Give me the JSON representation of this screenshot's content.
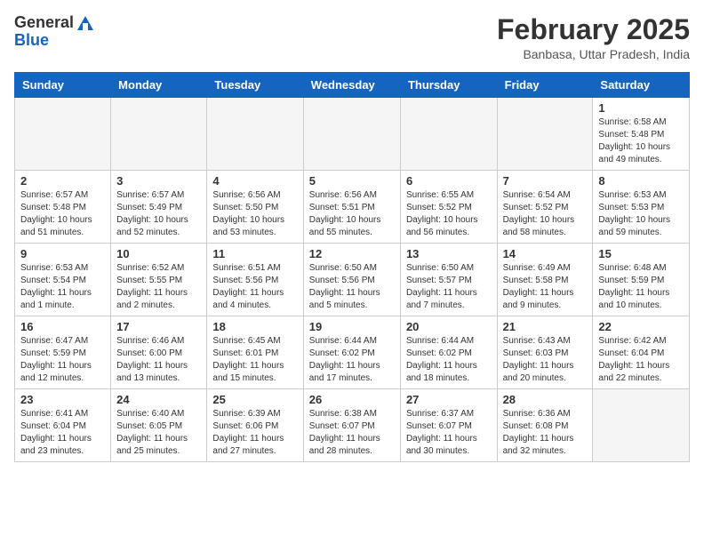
{
  "header": {
    "logo_general": "General",
    "logo_blue": "Blue",
    "month_title": "February 2025",
    "location": "Banbasa, Uttar Pradesh, India"
  },
  "weekdays": [
    "Sunday",
    "Monday",
    "Tuesday",
    "Wednesday",
    "Thursday",
    "Friday",
    "Saturday"
  ],
  "weeks": [
    [
      {
        "day": "",
        "info": ""
      },
      {
        "day": "",
        "info": ""
      },
      {
        "day": "",
        "info": ""
      },
      {
        "day": "",
        "info": ""
      },
      {
        "day": "",
        "info": ""
      },
      {
        "day": "",
        "info": ""
      },
      {
        "day": "1",
        "info": "Sunrise: 6:58 AM\nSunset: 5:48 PM\nDaylight: 10 hours and 49 minutes."
      }
    ],
    [
      {
        "day": "2",
        "info": "Sunrise: 6:57 AM\nSunset: 5:48 PM\nDaylight: 10 hours and 51 minutes."
      },
      {
        "day": "3",
        "info": "Sunrise: 6:57 AM\nSunset: 5:49 PM\nDaylight: 10 hours and 52 minutes."
      },
      {
        "day": "4",
        "info": "Sunrise: 6:56 AM\nSunset: 5:50 PM\nDaylight: 10 hours and 53 minutes."
      },
      {
        "day": "5",
        "info": "Sunrise: 6:56 AM\nSunset: 5:51 PM\nDaylight: 10 hours and 55 minutes."
      },
      {
        "day": "6",
        "info": "Sunrise: 6:55 AM\nSunset: 5:52 PM\nDaylight: 10 hours and 56 minutes."
      },
      {
        "day": "7",
        "info": "Sunrise: 6:54 AM\nSunset: 5:52 PM\nDaylight: 10 hours and 58 minutes."
      },
      {
        "day": "8",
        "info": "Sunrise: 6:53 AM\nSunset: 5:53 PM\nDaylight: 10 hours and 59 minutes."
      }
    ],
    [
      {
        "day": "9",
        "info": "Sunrise: 6:53 AM\nSunset: 5:54 PM\nDaylight: 11 hours and 1 minute."
      },
      {
        "day": "10",
        "info": "Sunrise: 6:52 AM\nSunset: 5:55 PM\nDaylight: 11 hours and 2 minutes."
      },
      {
        "day": "11",
        "info": "Sunrise: 6:51 AM\nSunset: 5:56 PM\nDaylight: 11 hours and 4 minutes."
      },
      {
        "day": "12",
        "info": "Sunrise: 6:50 AM\nSunset: 5:56 PM\nDaylight: 11 hours and 5 minutes."
      },
      {
        "day": "13",
        "info": "Sunrise: 6:50 AM\nSunset: 5:57 PM\nDaylight: 11 hours and 7 minutes."
      },
      {
        "day": "14",
        "info": "Sunrise: 6:49 AM\nSunset: 5:58 PM\nDaylight: 11 hours and 9 minutes."
      },
      {
        "day": "15",
        "info": "Sunrise: 6:48 AM\nSunset: 5:59 PM\nDaylight: 11 hours and 10 minutes."
      }
    ],
    [
      {
        "day": "16",
        "info": "Sunrise: 6:47 AM\nSunset: 5:59 PM\nDaylight: 11 hours and 12 minutes."
      },
      {
        "day": "17",
        "info": "Sunrise: 6:46 AM\nSunset: 6:00 PM\nDaylight: 11 hours and 13 minutes."
      },
      {
        "day": "18",
        "info": "Sunrise: 6:45 AM\nSunset: 6:01 PM\nDaylight: 11 hours and 15 minutes."
      },
      {
        "day": "19",
        "info": "Sunrise: 6:44 AM\nSunset: 6:02 PM\nDaylight: 11 hours and 17 minutes."
      },
      {
        "day": "20",
        "info": "Sunrise: 6:44 AM\nSunset: 6:02 PM\nDaylight: 11 hours and 18 minutes."
      },
      {
        "day": "21",
        "info": "Sunrise: 6:43 AM\nSunset: 6:03 PM\nDaylight: 11 hours and 20 minutes."
      },
      {
        "day": "22",
        "info": "Sunrise: 6:42 AM\nSunset: 6:04 PM\nDaylight: 11 hours and 22 minutes."
      }
    ],
    [
      {
        "day": "23",
        "info": "Sunrise: 6:41 AM\nSunset: 6:04 PM\nDaylight: 11 hours and 23 minutes."
      },
      {
        "day": "24",
        "info": "Sunrise: 6:40 AM\nSunset: 6:05 PM\nDaylight: 11 hours and 25 minutes."
      },
      {
        "day": "25",
        "info": "Sunrise: 6:39 AM\nSunset: 6:06 PM\nDaylight: 11 hours and 27 minutes."
      },
      {
        "day": "26",
        "info": "Sunrise: 6:38 AM\nSunset: 6:07 PM\nDaylight: 11 hours and 28 minutes."
      },
      {
        "day": "27",
        "info": "Sunrise: 6:37 AM\nSunset: 6:07 PM\nDaylight: 11 hours and 30 minutes."
      },
      {
        "day": "28",
        "info": "Sunrise: 6:36 AM\nSunset: 6:08 PM\nDaylight: 11 hours and 32 minutes."
      },
      {
        "day": "",
        "info": ""
      }
    ]
  ]
}
